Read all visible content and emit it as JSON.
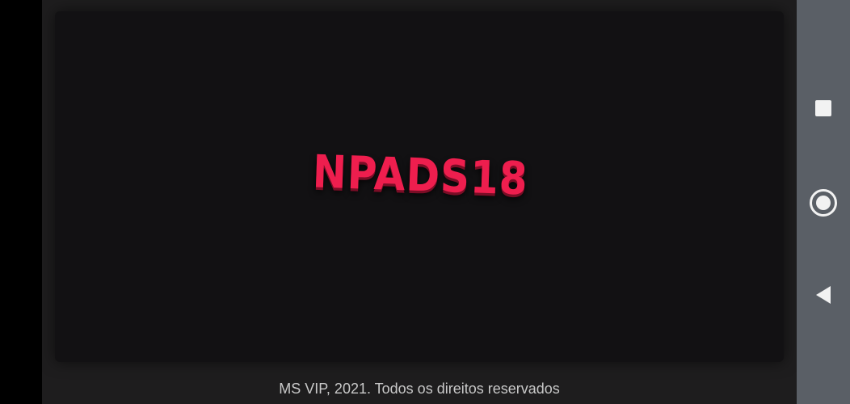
{
  "app": {
    "logo_text": "NPADS18",
    "footer_text": "MS VIP, 2021. Todos os direitos reservados",
    "accent_color": "#ee1e4e"
  },
  "navbar": {
    "buttons": [
      {
        "name": "recents",
        "icon": "square-icon"
      },
      {
        "name": "home",
        "icon": "circle-icon"
      },
      {
        "name": "back",
        "icon": "triangle-back-icon"
      }
    ]
  }
}
